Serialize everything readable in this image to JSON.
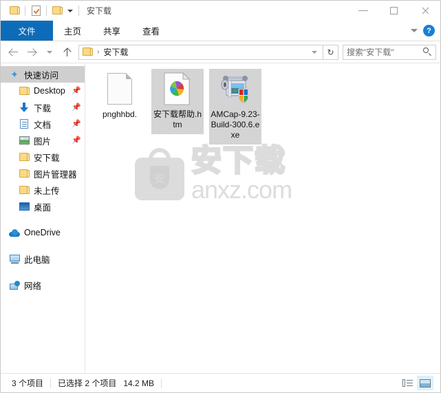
{
  "window": {
    "title": "安下载",
    "quick_access_toolbar": [
      {
        "name": "folder-properties",
        "icon": "folder-icon"
      },
      {
        "name": "properties",
        "icon": "properties-icon"
      },
      {
        "name": "new-folder",
        "icon": "folder-icon"
      },
      {
        "name": "customize",
        "icon": "chevron-down-icon"
      }
    ],
    "controls": {
      "minimize": "–",
      "maximize": "□",
      "close": "✕"
    }
  },
  "ribbon": {
    "tabs": [
      {
        "label": "文件",
        "active": true
      },
      {
        "label": "主页",
        "active": false
      },
      {
        "label": "共享",
        "active": false
      },
      {
        "label": "查看",
        "active": false
      }
    ],
    "expand_icon": "chevron-down-icon",
    "help_label": "?"
  },
  "addressbar": {
    "back_icon": "arrow-left-icon",
    "forward_icon": "arrow-right-icon",
    "recent_icon": "chevron-down-icon",
    "up_icon": "arrow-up-icon",
    "breadcrumb": {
      "root_icon": "folder-icon",
      "separator": "›",
      "path": "安下载"
    },
    "dropdown_icon": "chevron-down-icon",
    "refresh_icon": "↻",
    "search": {
      "placeholder": "搜索\"安下载\"",
      "icon": "search-icon"
    }
  },
  "sidebar": {
    "items": [
      {
        "label": "快速访问",
        "icon": "star-pin-icon",
        "selected": true,
        "level": 0,
        "pinned": false
      },
      {
        "label": "Desktop",
        "icon": "folder-icon",
        "selected": false,
        "level": 1,
        "pinned": true
      },
      {
        "label": "下载",
        "icon": "download-icon",
        "selected": false,
        "level": 1,
        "pinned": true
      },
      {
        "label": "文档",
        "icon": "documents-icon",
        "selected": false,
        "level": 1,
        "pinned": true
      },
      {
        "label": "图片",
        "icon": "pictures-icon",
        "selected": false,
        "level": 1,
        "pinned": true
      },
      {
        "label": "安下载",
        "icon": "folder-icon",
        "selected": false,
        "level": 1,
        "pinned": false
      },
      {
        "label": "图片管理器",
        "icon": "folder-icon",
        "selected": false,
        "level": 1,
        "pinned": false
      },
      {
        "label": "未上传",
        "icon": "folder-icon",
        "selected": false,
        "level": 1,
        "pinned": false
      },
      {
        "label": "桌面",
        "icon": "desktop-icon",
        "selected": false,
        "level": 1,
        "pinned": false
      },
      {
        "label": "OneDrive",
        "icon": "onedrive-icon",
        "selected": false,
        "level": 0,
        "pinned": false
      },
      {
        "label": "此电脑",
        "icon": "this-pc-icon",
        "selected": false,
        "level": 0,
        "pinned": false
      },
      {
        "label": "网络",
        "icon": "network-icon",
        "selected": false,
        "level": 0,
        "pinned": false
      }
    ]
  },
  "files": [
    {
      "name": "pnghhbd.",
      "icon": "blank-document-icon",
      "selected": false
    },
    {
      "name": "安下载帮助.htm",
      "icon": "html-document-icon",
      "selected": true
    },
    {
      "name": "AMCap-9.23-Build-300.6.exe",
      "icon": "camcorder-shield-icon",
      "selected": true
    }
  ],
  "watermark": {
    "icon": "bag-shield-icon",
    "cn_text": "安下载",
    "en_text": "anxz.com"
  },
  "statusbar": {
    "item_count": "3 个项目",
    "selection": "已选择 2 个项目",
    "size": "14.2 MB",
    "views": [
      {
        "name": "details-view-button",
        "icon": "details-icon",
        "active": false
      },
      {
        "name": "large-icons-view-button",
        "icon": "tiles-icon",
        "active": true
      }
    ]
  },
  "colors": {
    "accent": "#0d6cb9",
    "selection": "#d4d4d4",
    "sidebar_selection": "#cfcfcf",
    "folder": "#fcd986"
  }
}
